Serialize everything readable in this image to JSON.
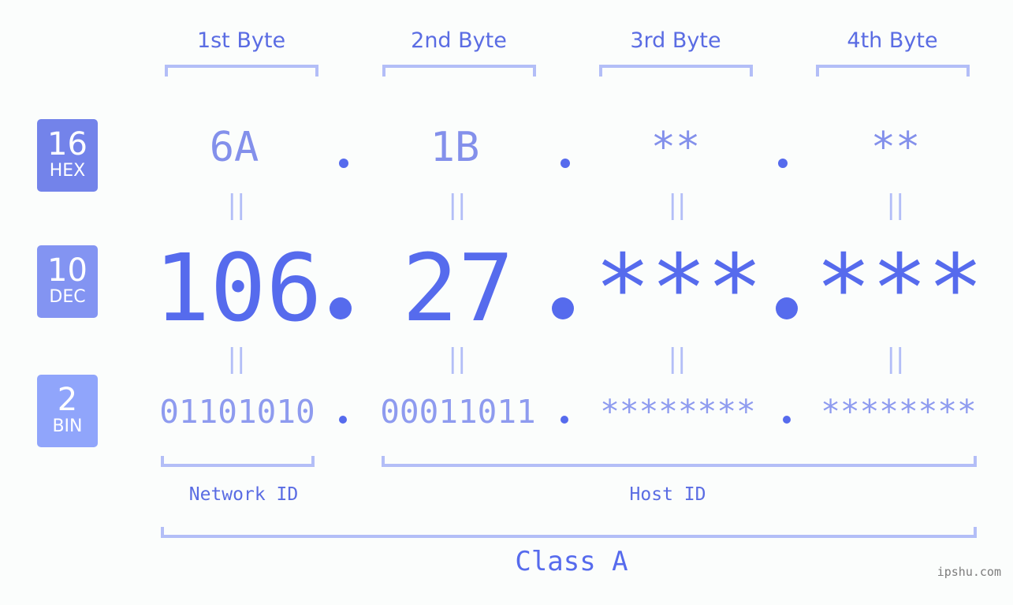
{
  "badges": {
    "hex": {
      "number": "16",
      "label": "HEX",
      "color": "#7383ea"
    },
    "dec": {
      "number": "10",
      "label": "DEC",
      "color": "#8394f2"
    },
    "bin": {
      "number": "2",
      "label": "BIN",
      "color": "#90a5fb"
    }
  },
  "bytes": [
    {
      "title": "1st Byte",
      "hex": "6A",
      "dec": "106",
      "bin": "01101010"
    },
    {
      "title": "2nd Byte",
      "hex": "1B",
      "dec": "27",
      "bin": "00011011"
    },
    {
      "title": "3rd Byte",
      "hex": "**",
      "dec": "***",
      "bin": "********"
    },
    {
      "title": "4th Byte",
      "hex": "**",
      "dec": "***",
      "bin": "********"
    }
  ],
  "equals_symbol": "||",
  "labels": {
    "network_id": "Network ID",
    "host_id": "Host ID",
    "class": "Class A"
  },
  "watermark": "ipshu.com",
  "colors": {
    "accent": "#566bed",
    "bracket": "#b3bef7",
    "hex_text": "#8390eb",
    "bin_text": "#8e9bef"
  }
}
